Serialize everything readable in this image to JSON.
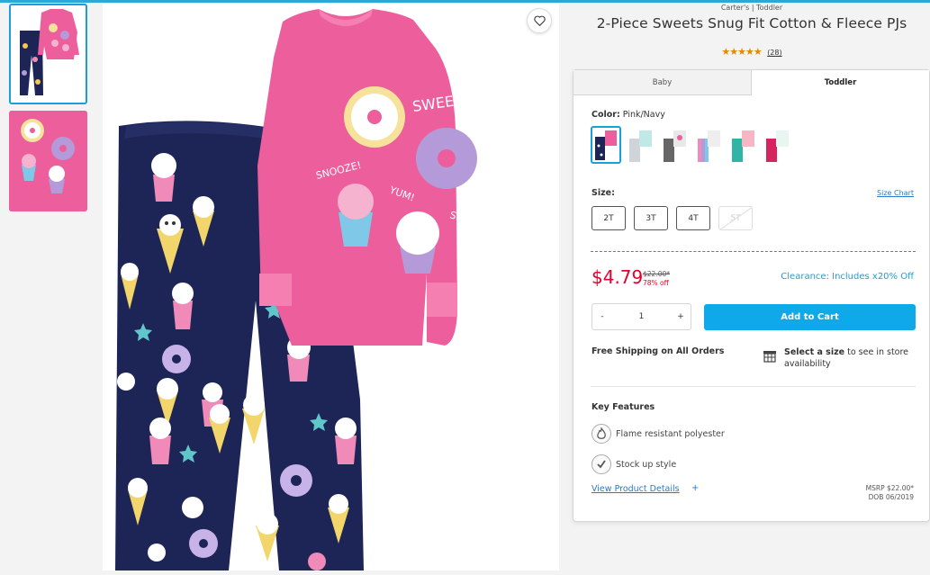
{
  "product": {
    "brand_path": "Carter's | Toddler",
    "title": "2-Piece Sweets Snug Fit Cotton & Fleece PJs",
    "stars": "★★★★★",
    "review_count": "(28)"
  },
  "tabs": [
    {
      "label": "Baby"
    },
    {
      "label": "Toddler"
    }
  ],
  "color": {
    "label": "Color:",
    "value": "Pink/Navy"
  },
  "size": {
    "label": "Size:",
    "chart_link": "Size Chart",
    "options": [
      "2T",
      "3T",
      "4T",
      "5T"
    ]
  },
  "pricing": {
    "price": "$4.79",
    "was": "$22.00*",
    "off": "78% off",
    "clearance": "Clearance: Includes x20% Off"
  },
  "cart": {
    "minus": "-",
    "qty": "1",
    "plus": "+",
    "add_label": "Add to Cart"
  },
  "shipping": {
    "free": "Free Shipping on All Orders",
    "store_bold": "Select a size",
    "store_rest": " to see in store availability"
  },
  "features": {
    "title": "Key Features",
    "items": [
      "Flame resistant polyester",
      "Stock up style"
    ],
    "details_link": "View Product Details",
    "details_plus": "+",
    "msrp": "MSRP $22.00*",
    "dob": "DOB 06/2019"
  },
  "image_text": {
    "sweet": "SWEET!",
    "snooze": "SNOOZE!",
    "yum": "YUM!",
    "smooch": "SMOOCH!"
  },
  "colors": {
    "accent": "#19a0d8",
    "cta": "#0fa8e8",
    "price": "#e4002b",
    "pink": "#ec5f9c",
    "navy": "#1d2456",
    "star": "#e08a00"
  }
}
